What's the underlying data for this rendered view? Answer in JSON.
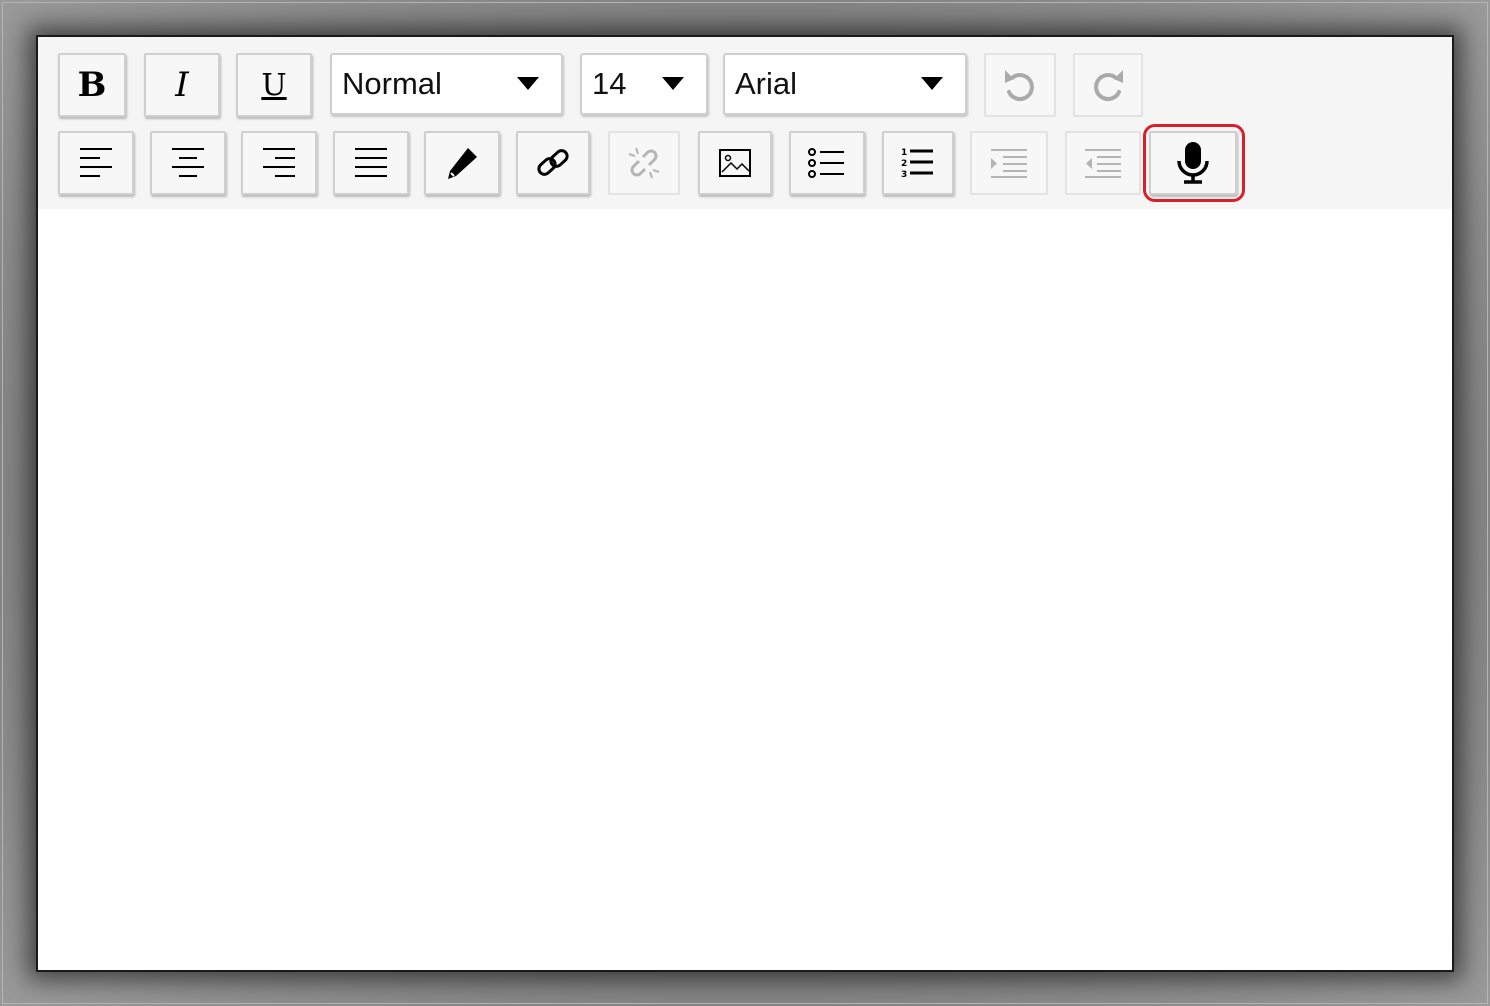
{
  "toolbar": {
    "style_select": {
      "value": "Normal"
    },
    "size_select": {
      "value": "14"
    },
    "font_select": {
      "value": "Arial"
    },
    "bold_label": "B",
    "italic_label": "I",
    "underline_label": "U"
  },
  "highlight_color": "#d6212b",
  "icons": {
    "row1": [
      "bold",
      "italic",
      "underline",
      "undo-icon",
      "redo-icon"
    ],
    "row2": [
      "align-left-icon",
      "align-center-icon",
      "align-right-icon",
      "align-justify-icon",
      "pen-icon",
      "link-icon",
      "unlink-icon",
      "image-icon",
      "bullet-list-icon",
      "numbered-list-icon",
      "indent-icon",
      "outdent-icon",
      "microphone-icon"
    ]
  },
  "disabled": [
    "undo",
    "redo",
    "unlink",
    "indent",
    "outdent"
  ]
}
